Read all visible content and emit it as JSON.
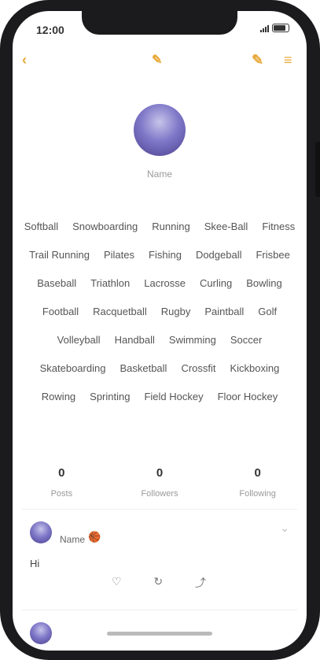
{
  "status": {
    "time": "12:00"
  },
  "nav": {
    "back": "‹",
    "center": "✎",
    "edit": "✎",
    "menu": "≡"
  },
  "profile": {
    "name": "Name"
  },
  "tags": [
    "Softball",
    "Snowboarding",
    "Running",
    "Skee-Ball",
    "Fitness",
    "Trail Running",
    "Pilates",
    "Fishing",
    "Dodgeball",
    "Frisbee",
    "Baseball",
    "Triathlon",
    "Lacrosse",
    "Curling",
    "Bowling",
    "Football",
    "Racquetball",
    "Rugby",
    "Paintball",
    "Golf",
    "Volleyball",
    "Handball",
    "Swimming",
    "Soccer",
    "Skateboarding",
    "Basketball",
    "Crossfit",
    "Kickboxing",
    "Rowing",
    "Sprinting",
    "Field Hockey",
    "Floor Hockey"
  ],
  "stats": [
    {
      "num": "0",
      "label": "Posts"
    },
    {
      "num": "0",
      "label": "Followers"
    },
    {
      "num": "0",
      "label": "Following"
    }
  ],
  "post": {
    "name": "Name",
    "badge": "🏀",
    "text": "Hi",
    "more": "⌄"
  },
  "post_actions": [
    "♡",
    "↻",
    "⤴"
  ],
  "colors": {
    "accent": "#e8a93a",
    "avatar": "#6f66be"
  }
}
